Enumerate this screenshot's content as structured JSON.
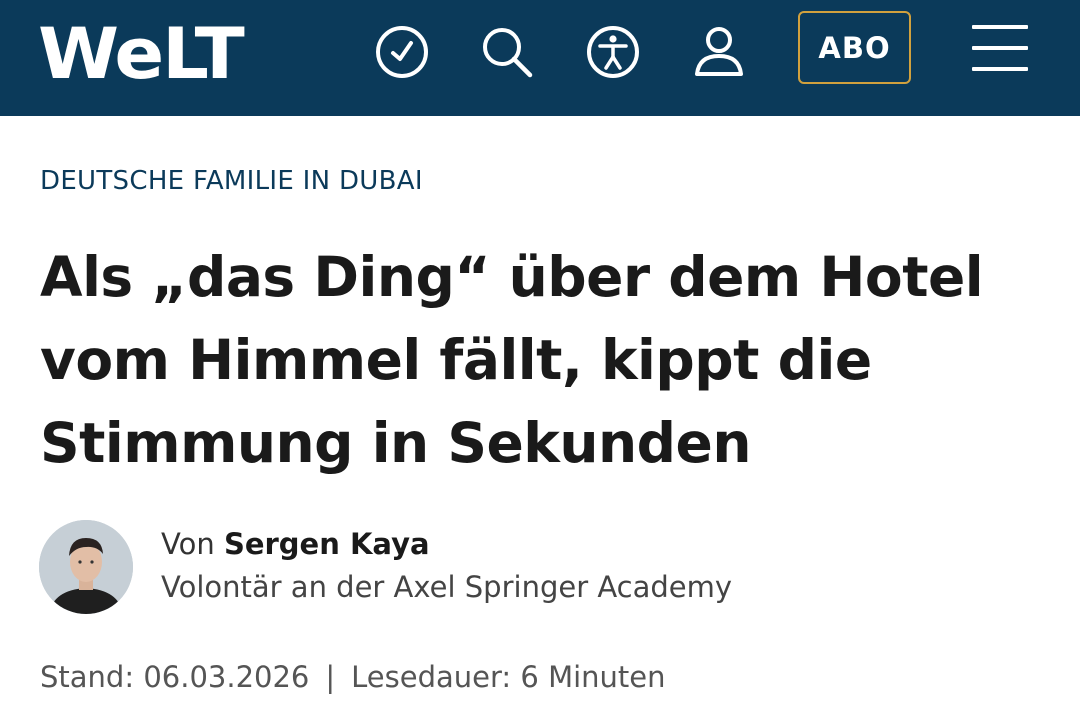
{
  "header": {
    "logo_text": "WeLT",
    "icons": [
      "clock-check-icon",
      "search-icon",
      "accessibility-icon",
      "user-icon",
      "menu-icon"
    ],
    "abo_label": "ABO",
    "background_color": "#0b3a5a",
    "abo_border_color": "#d1a13e"
  },
  "article": {
    "kicker": "DEUTSCHE FAMILIE IN DUBAI",
    "headline": "Als „das Ding“ über dem Hotel vom Himmel fällt, kippt die Stimmung in Sekunden",
    "byline_prefix": "Von",
    "author": "Sergen Kaya",
    "author_role": "Volontär an der Axel Springer Academy",
    "date_label": "Stand: 06.03.2026",
    "separator": "|",
    "reading_time": "Lesedauer: 6 Minuten"
  }
}
